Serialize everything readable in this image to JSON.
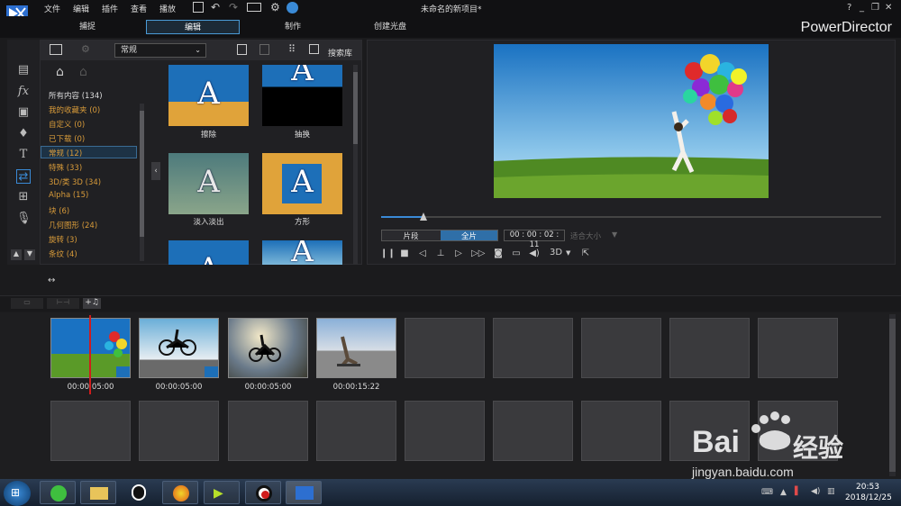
{
  "window": {
    "title": "未命名的新项目*",
    "brand": "PowerDirector",
    "controls": [
      "?",
      "_",
      "❐",
      "✕"
    ]
  },
  "menubar": [
    "文件",
    "编辑",
    "插件",
    "查看",
    "播放"
  ],
  "main_tabs": [
    "捕捉",
    "编辑",
    "制作",
    "创建光盘"
  ],
  "library": {
    "category_select": "常规",
    "search_label": "搜索库",
    "categories": [
      {
        "label": "所有内容 (134)",
        "color": "#dddddd"
      },
      {
        "label": "我的收藏夹  (0)",
        "color": "#d89b3a"
      },
      {
        "label": "自定义  (0)",
        "color": "#d89b3a"
      },
      {
        "label": "已下载  (0)",
        "color": "#d89b3a"
      },
      {
        "label": "常规  (12)",
        "color": "#d89b3a"
      },
      {
        "label": "特殊  (33)",
        "color": "#d89b3a"
      },
      {
        "label": "3D/类 3D  (34)",
        "color": "#d89b3a"
      },
      {
        "label": "Alpha  (15)",
        "color": "#d89b3a"
      },
      {
        "label": "块  (6)",
        "color": "#d89b3a"
      },
      {
        "label": "几何图形  (24)",
        "color": "#d89b3a"
      },
      {
        "label": "旋转  (3)",
        "color": "#d89b3a"
      },
      {
        "label": "条纹  (4)",
        "color": "#d89b3a"
      }
    ],
    "transitions": [
      "擦除",
      "抽换",
      "淡入淡出",
      "方形"
    ]
  },
  "preview": {
    "segment_tabs": [
      "片段",
      "全片"
    ],
    "timecode": "00 : 00 : 02 : 11",
    "fit_label": "适合大小",
    "mode_3d": "3D",
    "progress": 0.085
  },
  "storyboard": {
    "clips": [
      {
        "time": "00:00:05:00"
      },
      {
        "time": "00:00:05:00"
      },
      {
        "time": "00:00:05:00"
      },
      {
        "time": "00:00:15:22"
      }
    ]
  },
  "taskbar": {
    "time": "20:53",
    "date": "2018/12/25"
  },
  "watermark": {
    "brand": "Bai",
    "brand_suffix": "经验",
    "url": "jingyan.baidu.com"
  }
}
